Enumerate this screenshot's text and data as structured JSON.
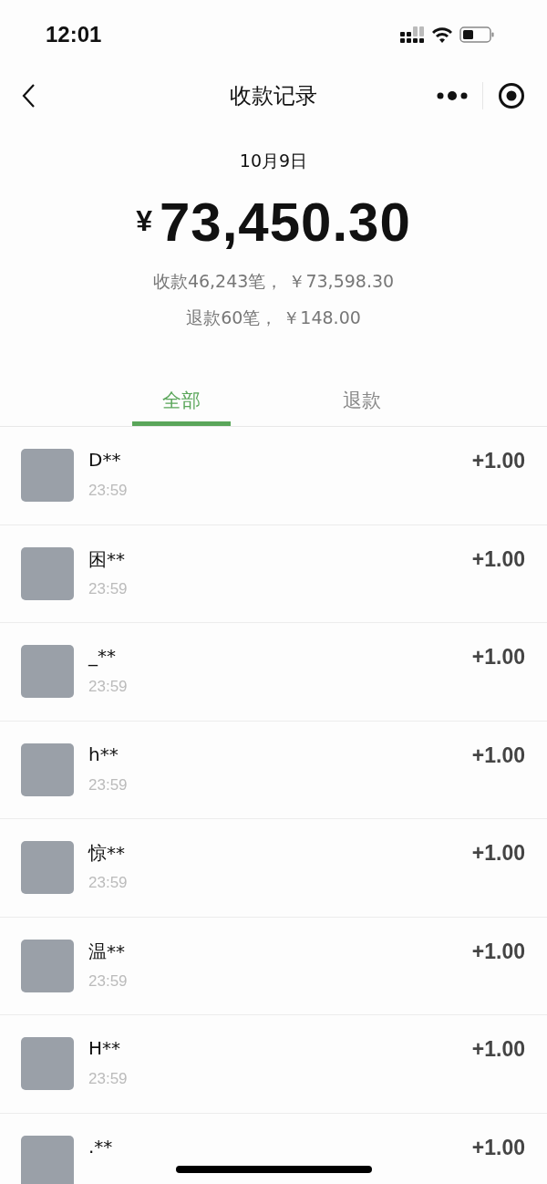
{
  "status_bar": {
    "time": "12:01"
  },
  "nav": {
    "title": "收款记录"
  },
  "summary": {
    "date": "10月9日",
    "currency": "¥",
    "total": "73,450.30",
    "lines": [
      "收款46,243笔， ￥73,598.30",
      "退款60笔， ￥148.00"
    ]
  },
  "tabs": [
    {
      "label": "全部",
      "selected": true
    },
    {
      "label": "退款",
      "selected": false
    }
  ],
  "records": [
    {
      "name": "D**",
      "time": "23:59",
      "amount": "+1.00"
    },
    {
      "name": "困**",
      "time": "23:59",
      "amount": "+1.00"
    },
    {
      "name": "_**",
      "time": "23:59",
      "amount": "+1.00"
    },
    {
      "name": "h**",
      "time": "23:59",
      "amount": "+1.00"
    },
    {
      "name": "惊**",
      "time": "23:59",
      "amount": "+1.00"
    },
    {
      "name": "温**",
      "time": "23:59",
      "amount": "+1.00"
    },
    {
      "name": "H**",
      "time": "23:59",
      "amount": "+1.00"
    },
    {
      "name": ".**",
      "amount": "+1.00"
    }
  ]
}
